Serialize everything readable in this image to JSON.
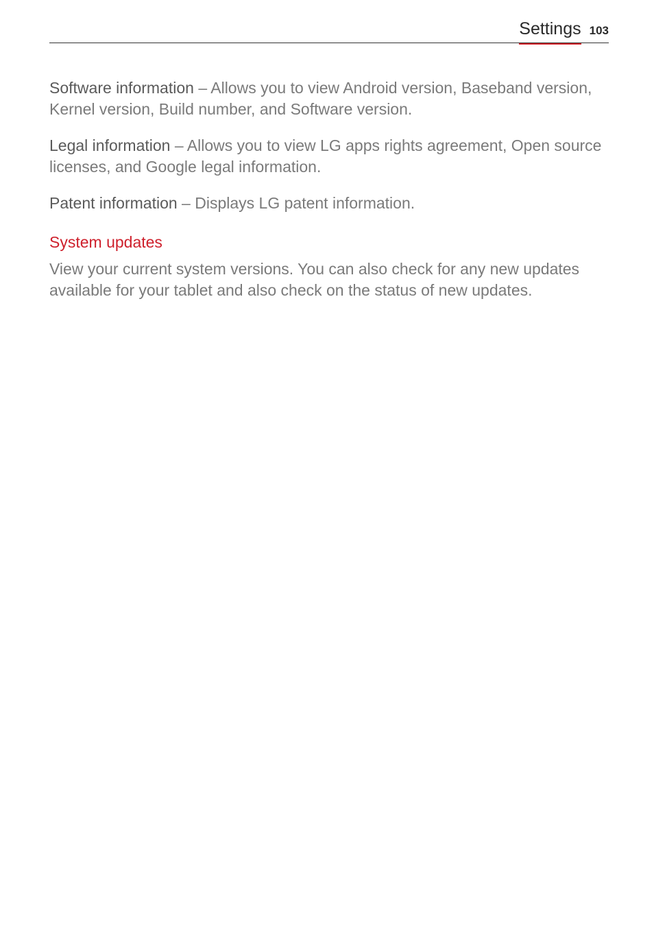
{
  "header": {
    "title": "Settings",
    "page_number": "103"
  },
  "paragraphs": {
    "software_info_term": "Software information",
    "software_info_body": " – Allows you to view Android version, Baseband version, Kernel version, Build number, and Software version.",
    "legal_info_term": "Legal information",
    "legal_info_body": " – Allows you to view LG apps rights agreement, Open source licenses, and Google legal information.",
    "patent_info_term": "Patent information",
    "patent_info_body": " – Displays LG patent information."
  },
  "section": {
    "heading": "System updates",
    "body": "View your current system versions. You can also check for any new updates available for your tablet and also check on the status of new updates."
  }
}
